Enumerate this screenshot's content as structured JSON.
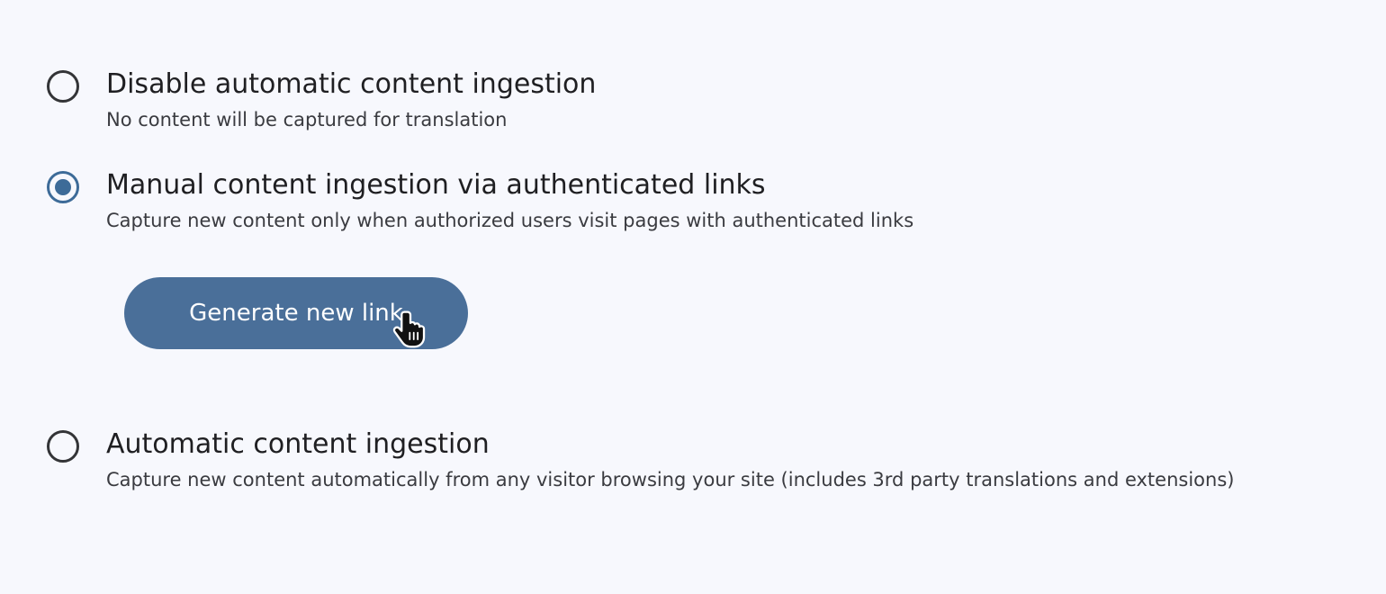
{
  "options": [
    {
      "title": "Disable automatic content ingestion",
      "description": "No content will be captured for translation",
      "selected": false
    },
    {
      "title": "Manual content ingestion via authenticated links",
      "description": "Capture new content only when authorized users visit pages with authenticated links",
      "selected": true
    },
    {
      "title": "Automatic content ingestion",
      "description": "Capture new content automatically from any visitor browsing your site (includes 3rd party translations and extensions)",
      "selected": false
    }
  ],
  "generate_button": {
    "label": "Generate new link"
  },
  "cursor": {
    "icon": "hand-pointer-icon"
  },
  "colors": {
    "background": "#f7f8fd",
    "accent": "#3d6b98",
    "button": "#4a6f99",
    "text": "#1f1f22",
    "secondary_text": "#3a3b40"
  }
}
